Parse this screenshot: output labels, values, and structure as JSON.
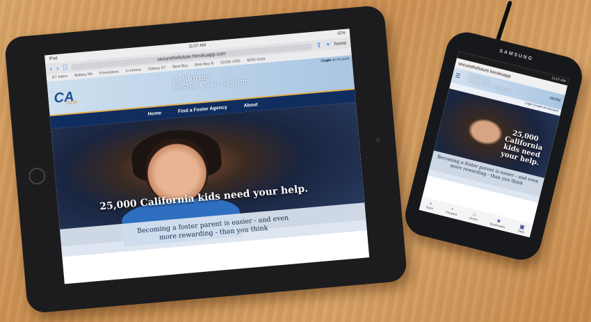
{
  "tablet": {
    "status_left": "iPad",
    "time": "11:07 AM",
    "battery": "42%",
    "url": "securethefuture.herokuapp.com",
    "tab_name": "home",
    "bookmarks": [
      "ST Intern",
      "Battery life",
      "Promotions",
      "in-intems",
      "Galaxy S7",
      "Best Buy",
      "Best Buy B",
      "52230 USD",
      "$200 Grait"
    ],
    "site_title_line1": "California",
    "site_title_line2": "Foster Care System",
    "logo_main": "CA",
    "logo_sub": ".GOV",
    "login": "Login",
    "create_account": "Create an Account",
    "nav": [
      "Home",
      "Find a Foster Agency",
      "About"
    ],
    "hero_headline": "25,000 California kids need your help.",
    "hero_sub_line1": "Becoming a foster parent is easier - and even",
    "hero_sub_line2": "more rewarding - than you think"
  },
  "phone": {
    "brand": "SAMSUNG",
    "time": "11:07 AM",
    "url": "securethefuture.herokuapp",
    "more": "MORE",
    "site_title_line1": "California",
    "site_title_line2": "Foster Care System",
    "login": "Login",
    "create_account": "Create an Account",
    "hero_headline": "25,000 California kids need your help.",
    "hero_sub": "Becoming a foster parent is easier - and even more rewarding - than you think",
    "bottom": [
      "Back",
      "Forward",
      "Home",
      "Bookmarks",
      "Tabs"
    ]
  }
}
